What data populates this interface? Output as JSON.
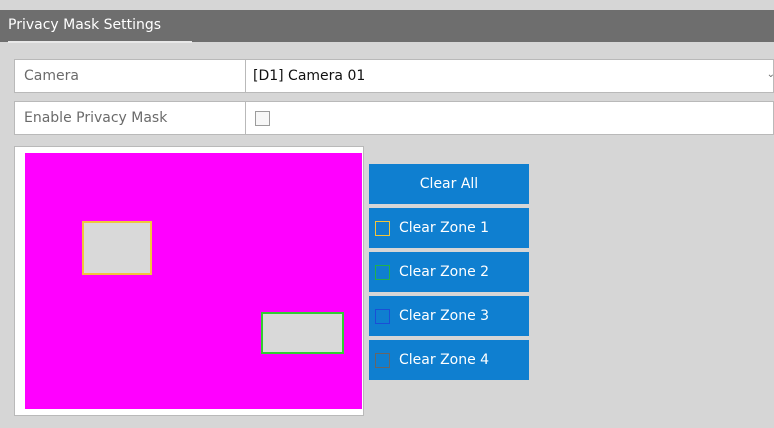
{
  "header": {
    "title": "Privacy Mask Settings"
  },
  "form": {
    "camera_label": "Camera",
    "camera_value": "[D1] Camera 01",
    "dropdown_icon": "chevron-down-icon",
    "enable_label": "Enable Privacy Mask",
    "enable_checked": false
  },
  "preview": {
    "background_color": "#ff00ff",
    "zones": [
      {
        "name": "Zone 1",
        "color": "#f0c53c"
      },
      {
        "name": "Zone 2",
        "color": "#33cc33"
      }
    ]
  },
  "buttons": {
    "clear_all": "Clear All",
    "zones": [
      {
        "label": "Clear Zone 1",
        "color": "#f0c53c"
      },
      {
        "label": "Clear Zone 2",
        "color": "#22b14c"
      },
      {
        "label": "Clear Zone 3",
        "color": "#1a4fd6"
      },
      {
        "label": "Clear Zone 4",
        "color": "#666666"
      }
    ]
  }
}
